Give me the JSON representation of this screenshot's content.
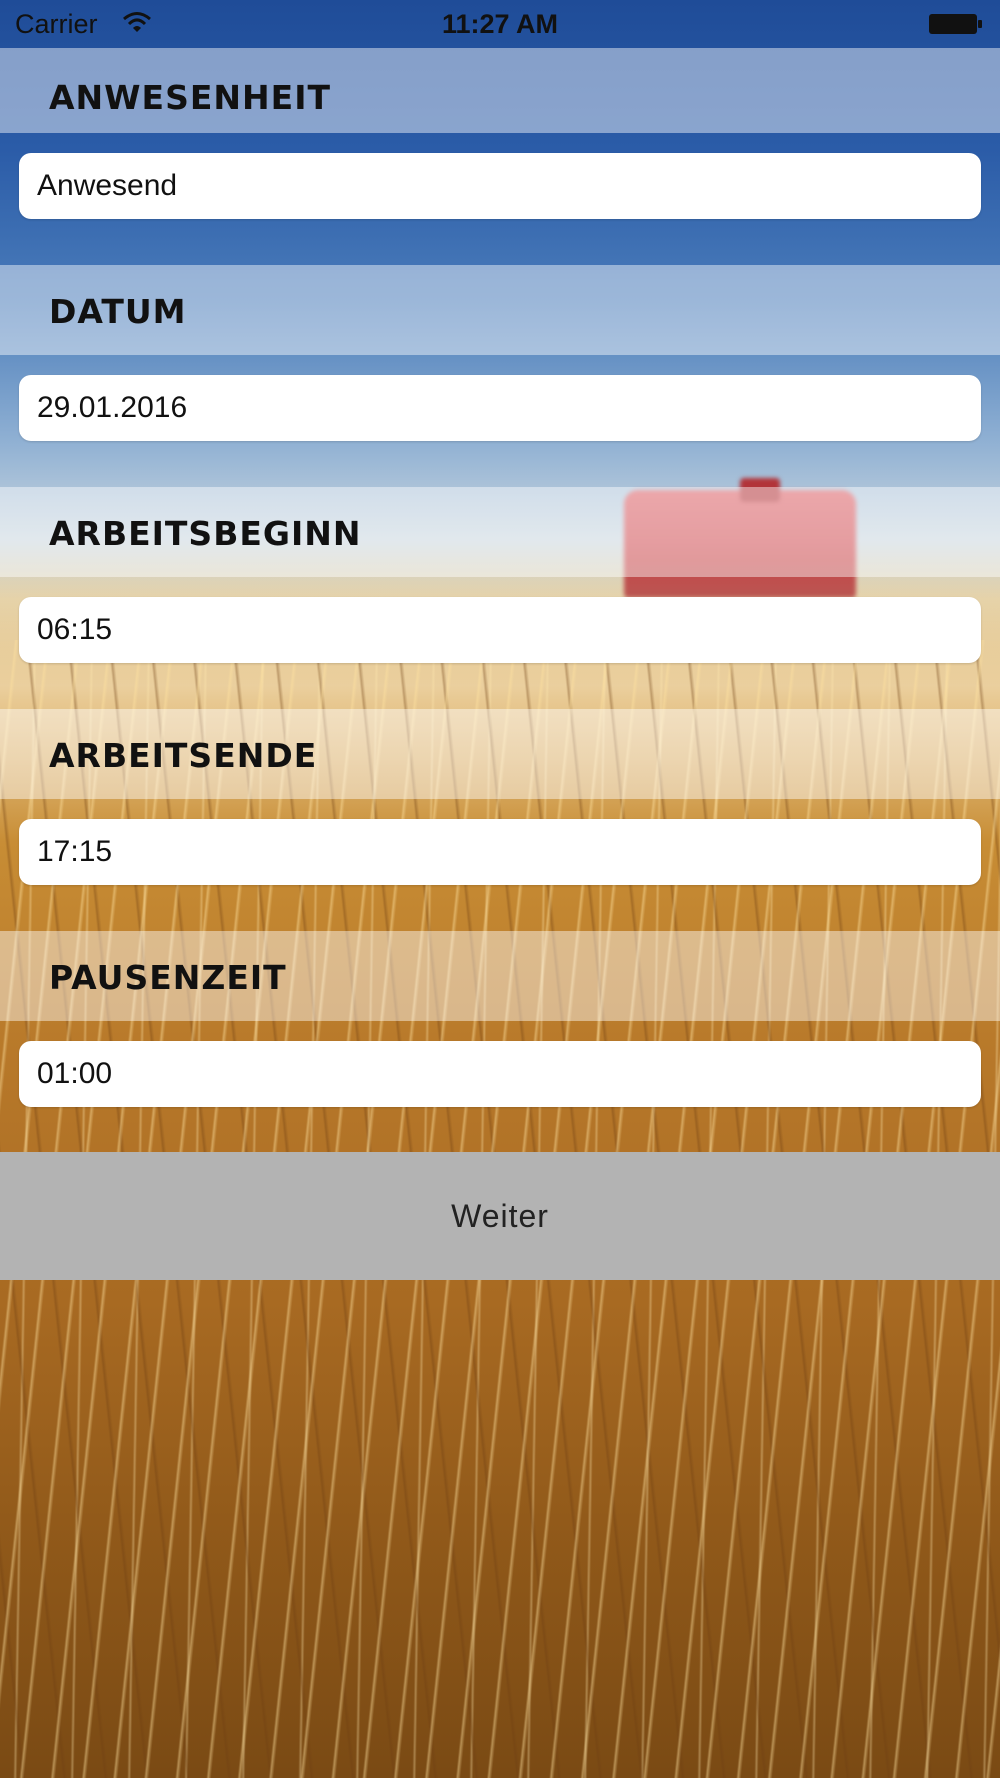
{
  "status_bar": {
    "carrier": "Carrier",
    "time": "11:27 AM",
    "wifi_icon": "wifi-icon",
    "battery_icon": "battery-icon"
  },
  "form": {
    "sections": [
      {
        "label": "ANWESENHEIT",
        "value": "Anwesend"
      },
      {
        "label": "DATUM",
        "value": "29.01.2016"
      },
      {
        "label": "ARBEITSBEGINN",
        "value": "06:15"
      },
      {
        "label": "ARBEITSENDE",
        "value": "17:15"
      },
      {
        "label": "PAUSENZEIT",
        "value": "01:00"
      }
    ]
  },
  "actions": {
    "next_label": "Weiter"
  },
  "colors": {
    "button_bg": "#b3b3b3",
    "label_band_bg": "rgba(255,255,255,0.45)",
    "field_bg": "#ffffff"
  }
}
